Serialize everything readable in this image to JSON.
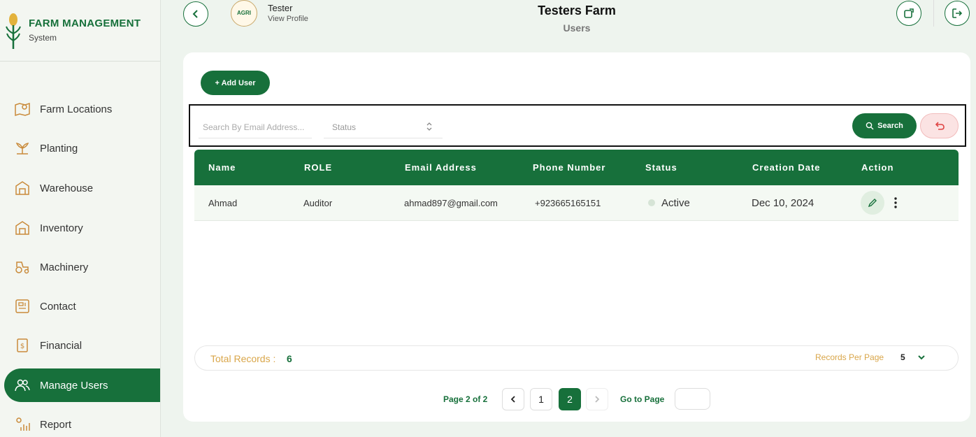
{
  "brand": {
    "title": "FARM MANAGEMENT",
    "subtitle": "System"
  },
  "sidebar": {
    "items": [
      {
        "label": "Farm Locations",
        "icon": "map-pin-icon",
        "active": false
      },
      {
        "label": "Planting",
        "icon": "plant-icon",
        "active": false
      },
      {
        "label": "Warehouse",
        "icon": "warehouse-icon",
        "active": false
      },
      {
        "label": "Inventory",
        "icon": "inventory-icon",
        "active": false
      },
      {
        "label": "Machinery",
        "icon": "tractor-icon",
        "active": false
      },
      {
        "label": "Contact",
        "icon": "contact-icon",
        "active": false
      },
      {
        "label": "Financial",
        "icon": "receipt-icon",
        "active": false
      },
      {
        "label": "Manage Users",
        "icon": "users-icon",
        "active": true
      },
      {
        "label": "Report",
        "icon": "report-icon",
        "active": false
      }
    ]
  },
  "header": {
    "user_name": "Tester",
    "user_link": "View Profile",
    "avatar_text": "AGRI",
    "farm_title": "Testers Farm",
    "page_subtitle": "Users"
  },
  "toolbar": {
    "add_user_label": "+ Add User"
  },
  "filters": {
    "search_placeholder": "Search By Email Address...",
    "status_placeholder": "Status",
    "search_button": "Search"
  },
  "table": {
    "columns": [
      "Name",
      "ROLE",
      "Email Address",
      "Phone Number",
      "Status",
      "Creation Date",
      "Action"
    ],
    "rows": [
      {
        "name": "Ahmad",
        "role": "Auditor",
        "email": "ahmad897@gmail.com",
        "phone": "+923665165151",
        "status": "Active",
        "created": "Dec 10, 2024"
      }
    ]
  },
  "footer": {
    "total_label": "Total Records :",
    "total_value": "6",
    "rpp_label": "Records Per Page",
    "rpp_value": "5",
    "page_info": "Page 2 of 2",
    "pages": [
      "1",
      "2"
    ],
    "current_page": "2",
    "goto_label": "Go to Page"
  },
  "colors": {
    "primary": "#17703b",
    "accent": "#d9a64a",
    "reset_bg": "#fbe3e3"
  }
}
